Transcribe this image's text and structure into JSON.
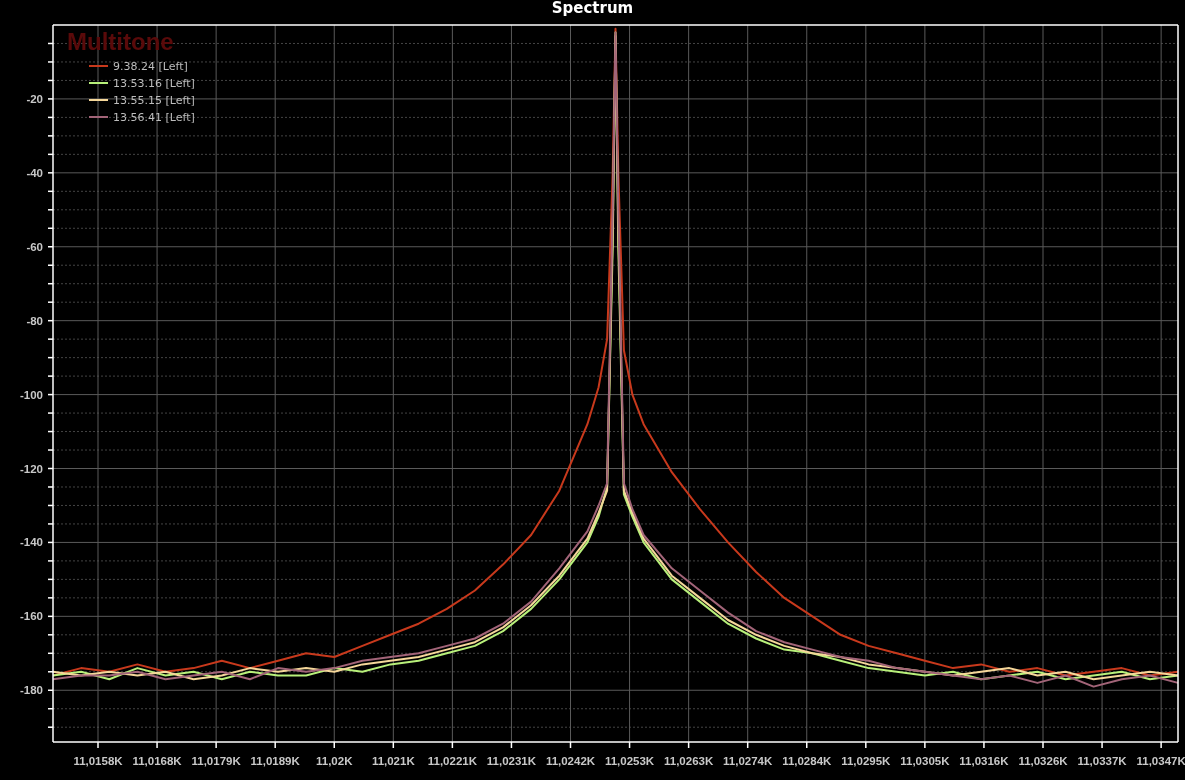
{
  "chart": {
    "caption": "Multitone",
    "chart_data": {
      "type": "line",
      "title": "Spectrum",
      "grid": true,
      "legend": true,
      "x": [
        11015,
        11015.5,
        11016,
        11016.5,
        11017,
        11017.5,
        11018,
        11018.5,
        11019,
        11019.5,
        11020,
        11020.5,
        11021,
        11021.5,
        11022,
        11022.5,
        11023,
        11023.5,
        11024,
        11024.5,
        11024.7,
        11024.85,
        11024.95,
        11025,
        11025.05,
        11025.15,
        11025.3,
        11025.5,
        11026,
        11026.5,
        11027,
        11027.5,
        11028,
        11028.5,
        11029,
        11029.5,
        11030,
        11030.5,
        11031,
        11031.5,
        11032,
        11032.5,
        11033,
        11033.5,
        11034,
        11034.5,
        11035
      ],
      "series": [
        {
          "name": "9.38.24 [Left]",
          "color": "#c8391c",
          "values": [
            -176,
            -174,
            -175,
            -173,
            -175,
            -174,
            -172,
            -174,
            -172,
            -170,
            -171,
            -168,
            -165,
            -162,
            -158,
            -153,
            -146,
            -138,
            -126,
            -108,
            -98,
            -85,
            -40,
            -1,
            -40,
            -88,
            -100,
            -108,
            -121,
            -131,
            -140,
            -148,
            -155,
            -160,
            -165,
            -168,
            -170,
            -172,
            -174,
            -173,
            -175,
            -174,
            -176,
            -175,
            -174,
            -176,
            -175
          ]
        },
        {
          "name": "13.53.16 [Left]",
          "color": "#b8f07a",
          "values": [
            -176,
            -175,
            -177,
            -174,
            -176,
            -175,
            -177,
            -175,
            -176,
            -176,
            -174,
            -175,
            -173,
            -172,
            -170,
            -168,
            -164,
            -158,
            -150,
            -140,
            -133,
            -125,
            -60,
            -2,
            -60,
            -127,
            -133,
            -140,
            -150,
            -156,
            -162,
            -166,
            -169,
            -170,
            -172,
            -174,
            -175,
            -176,
            -175,
            -177,
            -176,
            -175,
            -177,
            -176,
            -175,
            -177,
            -176
          ]
        },
        {
          "name": "13.55.15 [Left]",
          "color": "#f5d79a",
          "values": [
            -175,
            -176,
            -175,
            -176,
            -175,
            -177,
            -176,
            -174,
            -175,
            -174,
            -175,
            -173,
            -172,
            -171,
            -169,
            -167,
            -163,
            -157,
            -149,
            -139,
            -132,
            -126,
            -55,
            -3,
            -55,
            -126,
            -132,
            -139,
            -149,
            -155,
            -161,
            -165,
            -168,
            -170,
            -171,
            -173,
            -174,
            -175,
            -176,
            -175,
            -174,
            -176,
            -175,
            -177,
            -176,
            -175,
            -176
          ]
        },
        {
          "name": "13.56.41 [Left]",
          "color": "#a26478",
          "values": [
            -177,
            -176,
            -176,
            -175,
            -177,
            -176,
            -175,
            -177,
            -174,
            -175,
            -174,
            -172,
            -171,
            -170,
            -168,
            -166,
            -162,
            -156,
            -147,
            -137,
            -130,
            -124,
            -50,
            -2,
            -50,
            -124,
            -131,
            -138,
            -147,
            -153,
            -159,
            -164,
            -167,
            -169,
            -171,
            -172,
            -174,
            -175,
            -176,
            -177,
            -176,
            -178,
            -176,
            -179,
            -177,
            -176,
            -178
          ]
        }
      ],
      "xlim": [
        11015,
        11035
      ],
      "ylim": [
        -194,
        0
      ],
      "xticks": [
        {
          "value": 11015.8,
          "label": "11,0158K"
        },
        {
          "value": 11016.85,
          "label": "11,0168K"
        },
        {
          "value": 11017.9,
          "label": "11,0179K"
        },
        {
          "value": 11018.95,
          "label": "11,0189K"
        },
        {
          "value": 11020,
          "label": "11,02K"
        },
        {
          "value": 11021.05,
          "label": "11,021K"
        },
        {
          "value": 11022.1,
          "label": "11,0221K"
        },
        {
          "value": 11023.15,
          "label": "11,0231K"
        },
        {
          "value": 11024.2,
          "label": "11,0242K"
        },
        {
          "value": 11025.25,
          "label": "11,0253K"
        },
        {
          "value": 11026.3,
          "label": "11,0263K"
        },
        {
          "value": 11027.35,
          "label": "11,0274K"
        },
        {
          "value": 11028.4,
          "label": "11,0284K"
        },
        {
          "value": 11029.45,
          "label": "11,0295K"
        },
        {
          "value": 11030.5,
          "label": "11,0305K"
        },
        {
          "value": 11031.55,
          "label": "11,0316K"
        },
        {
          "value": 11032.6,
          "label": "11,0326K"
        },
        {
          "value": 11033.65,
          "label": "11,0337K"
        },
        {
          "value": 11034.7,
          "label": "11,0347K"
        }
      ],
      "yticks": [
        -20,
        -40,
        -60,
        -80,
        -100,
        -120,
        -140,
        -160,
        -180
      ]
    }
  }
}
